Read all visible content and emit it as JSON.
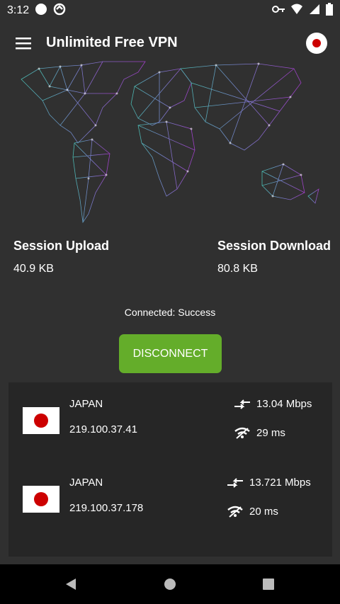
{
  "status_bar": {
    "time": "3:12"
  },
  "app_bar": {
    "title": "Unlimited Free VPN"
  },
  "stats": {
    "upload": {
      "label": "Session Upload",
      "value": "40.9 KB"
    },
    "download": {
      "label": "Session Download",
      "value": "80.8 KB"
    }
  },
  "connection": {
    "status": "Connected: Success",
    "button_label": "DISCONNECT"
  },
  "servers": [
    {
      "country": "JAPAN",
      "ip": "219.100.37.41",
      "speed": "13.04 Mbps",
      "ping": "29 ms"
    },
    {
      "country": "JAPAN",
      "ip": "219.100.37.178",
      "speed": "13.721 Mbps",
      "ping": "20 ms"
    }
  ],
  "colors": {
    "background": "#303030",
    "accent_green": "#64ad2a",
    "map_left": "#4fd1c5",
    "map_right": "#b340e0",
    "flag_red": "#cc0000"
  }
}
